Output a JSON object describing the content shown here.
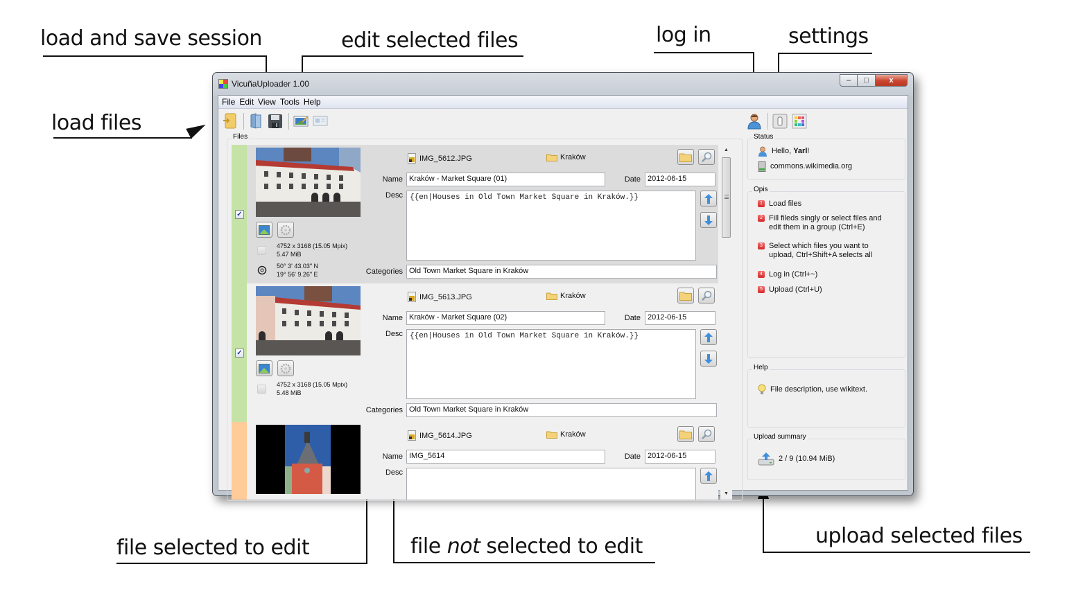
{
  "annotations": {
    "load_and_save_session": "load and save session",
    "edit_selected_files": "edit selected files",
    "load_files": "load files",
    "log_in": "log in",
    "settings": "settings",
    "file_selected_to_edit": "file selected to edit",
    "file_not_selected_prefix": "file ",
    "file_not_selected_emph": "not",
    "file_not_selected_suffix": " selected to edit",
    "upload_selected_files": "upload selected files"
  },
  "window": {
    "title": "VicuñaUploader 1.00",
    "controls": {
      "minimize": "–",
      "maximize": "□",
      "close": "x"
    }
  },
  "menu": [
    "File",
    "Edit",
    "View",
    "Tools",
    "Help"
  ],
  "toolbar": {
    "left_icons": [
      "load-files-icon",
      "load-session-icon",
      "save-session-icon",
      "edit-selected-icon",
      "presentation-icon"
    ],
    "right_icons": [
      "login-user-icon",
      "settings-switch-icon",
      "color-palette-icon"
    ]
  },
  "files_group": {
    "title": "Files",
    "labels": {
      "name": "Name",
      "desc": "Desc",
      "date": "Date",
      "categories": "Categories"
    },
    "rows": [
      {
        "state": "selected",
        "status_color": "#c5e3a6",
        "checked": true,
        "checkbox_mark": "✓",
        "filename": "IMG_5612.JPG",
        "folder": "Kraków",
        "name": "Kraków - Market Square (01)",
        "date": "2012-06-15",
        "desc": "{{en|Houses in Old Town Market Square in Kraków.}}",
        "categories": "Old Town Market Square in Kraków",
        "dimensions": "4752 x 3168 (15.05 Mpix)",
        "size": "5.47 MiB",
        "lat": "50° 3' 43.03\" N",
        "lon": "19° 56' 9.26\" E"
      },
      {
        "state": "normal",
        "status_color": "#c5e3a6",
        "checked": true,
        "checkbox_mark": "✓",
        "filename": "IMG_5613.JPG",
        "folder": "Kraków",
        "name": "Kraków - Market Square (02)",
        "date": "2012-06-15",
        "desc": "{{en|Houses in Old Town Market Square in Kraków.}}",
        "categories": "Old Town Market Square in Kraków",
        "dimensions": "4752 x 3168 (15.05 Mpix)",
        "size": "5.48 MiB"
      },
      {
        "state": "normal",
        "status_color": "#ffcc99",
        "checked": false,
        "filename": "IMG_5614.JPG",
        "folder": "Kraków",
        "name": "IMG_5614",
        "date": "2012-06-15",
        "desc": ""
      }
    ]
  },
  "status_group": {
    "title": "Status",
    "greeting_prefix": "Hello, ",
    "user": "Yarl",
    "greeting_suffix": "!",
    "server": "commons.wikimedia.org"
  },
  "opis_group": {
    "title": "Opis",
    "steps": [
      {
        "num": "1",
        "text": "Load files"
      },
      {
        "num": "2",
        "text": "Fill fileds singly or select files and edit them in a group (Ctrl+E)"
      },
      {
        "num": "3",
        "text": "Select which files you want to upload, Ctrl+Shift+A selects all"
      },
      {
        "num": "4",
        "text": "Log in (Ctrl+~)"
      },
      {
        "num": "5",
        "text": "Upload (Ctrl+U)"
      }
    ]
  },
  "help_group": {
    "title": "Help",
    "text": "File description, use wikitext."
  },
  "upload_summary": {
    "title": "Upload summary",
    "text": "2 / 9 (10.94 MiB)"
  },
  "colors": {
    "selected_row_bg": "#dcdcdc",
    "ready_status": "#c5e3a6",
    "pending_status": "#ffcc99",
    "step_badge": "#d42a2a",
    "close_button": "#c9452f"
  }
}
